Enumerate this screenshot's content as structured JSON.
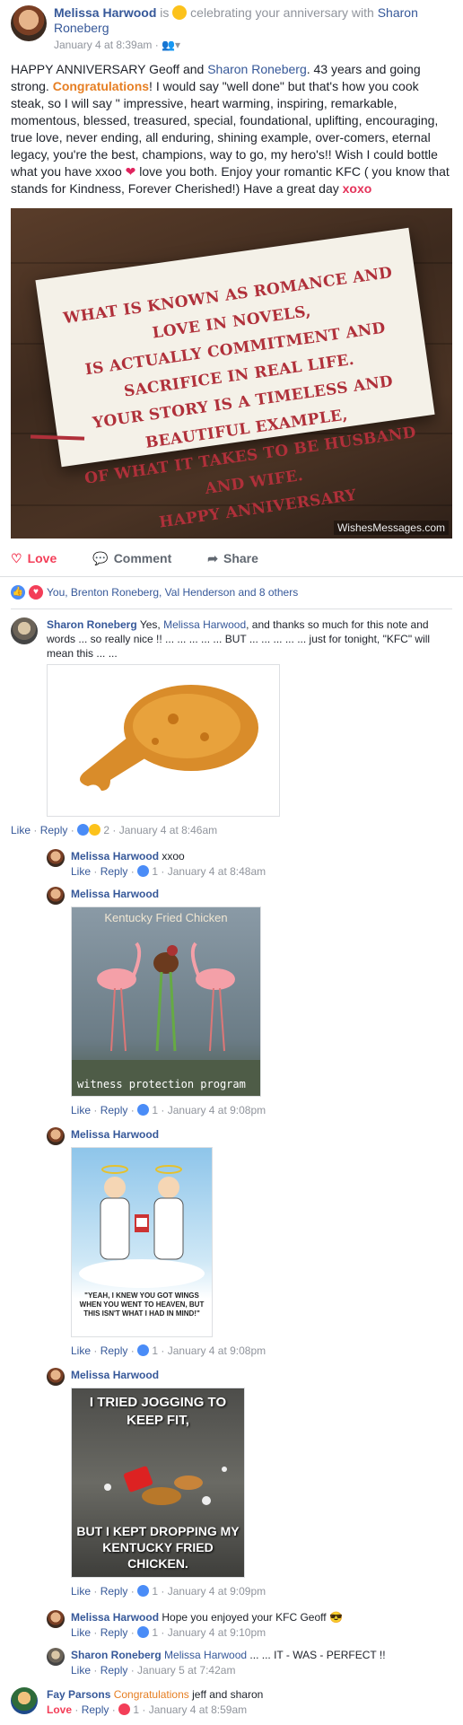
{
  "post": {
    "author": "Melissa Harwood",
    "is_text": "is",
    "feeling_text": "celebrating your anniversary with",
    "tagged": "Sharon Roneberg",
    "timestamp": "January 4 at 8:39am",
    "privacy_icon": "friends-icon",
    "body_1": "HAPPY ANNIVERSARY Geoff and",
    "body_mention": "Sharon Roneberg",
    "body_2": ". 43 years and going strong.",
    "body_congrats": "Congratulations",
    "body_3": "! I would say \"well done\" but that's how you cook steak, so I will say \" impressive, heart warming, inspiring, remarkable, momentous, blessed, treasured, special, foundational, uplifting, encouraging, true love, never ending, all enduring, shining example, over-comers, eternal legacy, you're the best, champions, way to go, my hero's!! Wish I could bottle what you have xxoo",
    "body_4": "love you both. Enjoy your romantic KFC ( you know that stands for Kindness, Forever Cherished!) Have a great day",
    "body_xoxo": "xoxo",
    "photo_lines": [
      "WHAT IS KNOWN AS ROMANCE AND LOVE IN NOVELS,",
      "IS ACTUALLY COMMITMENT AND SACRIFICE IN REAL LIFE.",
      "YOUR STORY IS A TIMELESS AND BEAUTIFUL EXAMPLE,",
      "OF WHAT IT TAKES TO BE HUSBAND AND WIFE.",
      "HAPPY ANNIVERSARY"
    ],
    "photo_watermark": "WishesMessages.com"
  },
  "actions": {
    "love": "Love",
    "comment": "Comment",
    "share": "Share"
  },
  "reactions_summary": "You, Brenton Roneberg, Val Henderson and 8 others",
  "comments": [
    {
      "author": "Sharon Roneberg",
      "text": "Yes,",
      "mention": "Melissa Harwood",
      "text2": ", and thanks so much for this note and words ... so really nice !! ... ... ... ... ... BUT ... ... ... ... ... just for tonight, \"KFC\" will mean this ... ...",
      "like": "Like",
      "reply": "Reply",
      "count": "2",
      "time": "January 4 at 8:46am"
    },
    {
      "author": "Melissa Harwood",
      "text": "xxoo",
      "like": "Like",
      "reply": "Reply",
      "count": "1",
      "time": "January 4 at 8:48am"
    },
    {
      "author": "Melissa Harwood",
      "img_title": "Kentucky Fried Chicken",
      "img_caption": "witness protection program",
      "like": "Like",
      "reply": "Reply",
      "count": "1",
      "time": "January 4 at 9:08pm"
    },
    {
      "author": "Melissa Harwood",
      "img_caption": "\"YEAH, I KNEW YOU GOT WINGS WHEN YOU WENT TO HEAVEN, BUT THIS ISN'T WHAT I HAD IN MIND!\"",
      "like": "Like",
      "reply": "Reply",
      "count": "1",
      "time": "January 4 at 9:08pm"
    },
    {
      "author": "Melissa Harwood",
      "img_top": "I TRIED JOGGING TO KEEP FIT,",
      "img_bottom": "BUT I KEPT DROPPING MY KENTUCKY FRIED CHICKEN.",
      "like": "Like",
      "reply": "Reply",
      "count": "1",
      "time": "January 4 at 9:09pm"
    },
    {
      "author": "Melissa Harwood",
      "text": "Hope you enjoyed your KFC Geoff",
      "like": "Like",
      "reply": "Reply",
      "count": "1",
      "time": "January 4 at 9:10pm"
    },
    {
      "author": "Sharon Roneberg",
      "mention": "Melissa Harwood",
      "text": "... ... IT - WAS - PERFECT !!",
      "like": "Like",
      "reply": "Reply",
      "time": "January 5 at 7:42am"
    },
    {
      "author": "Fay Parsons",
      "congrats": "Congratulations",
      "text": "jeff and sharon",
      "like": "Love",
      "reply": "Reply",
      "count": "1",
      "time": "January 4 at 8:59am"
    }
  ],
  "colors": {
    "link": "#365899",
    "love": "#f33e58",
    "like": "#4a8cf7",
    "muted": "#90949c"
  }
}
